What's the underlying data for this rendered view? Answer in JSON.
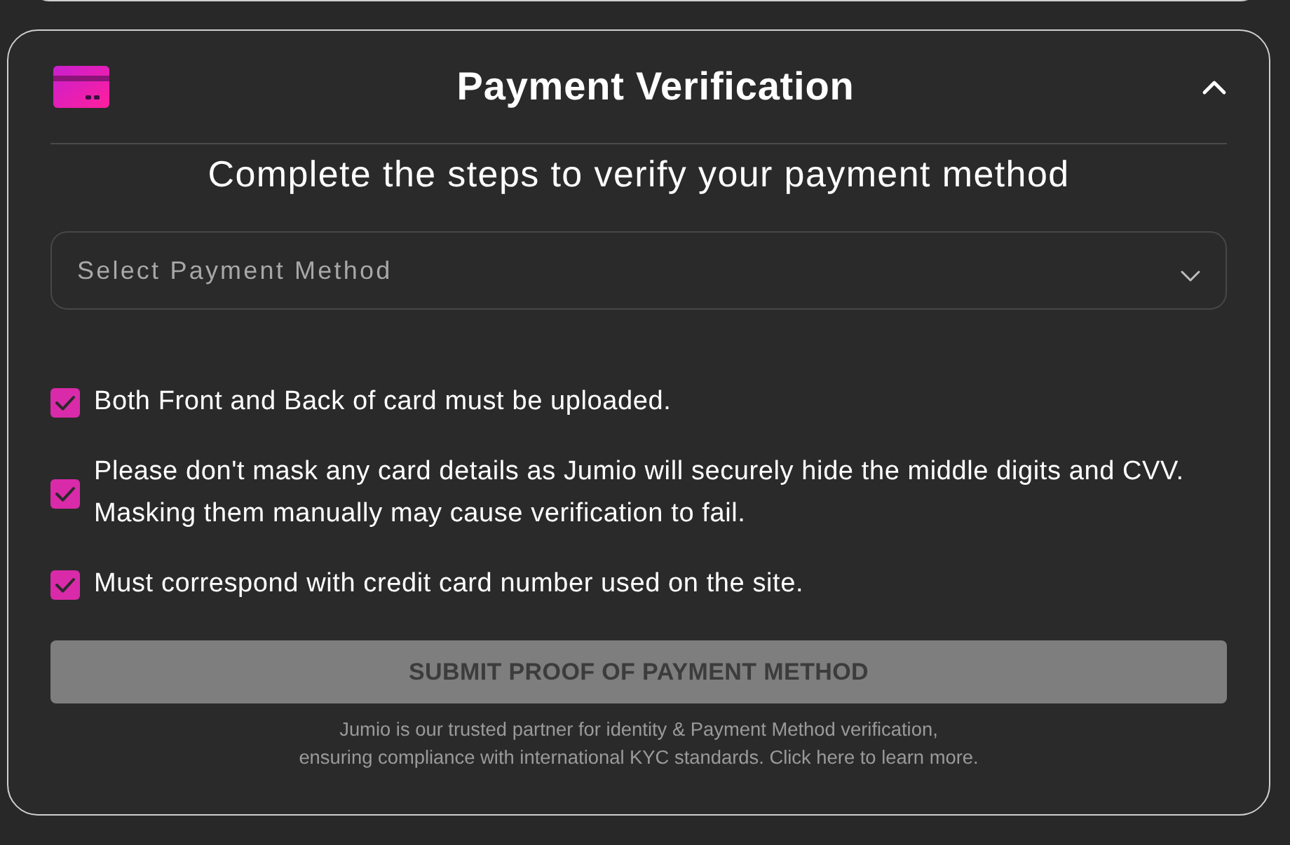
{
  "panel": {
    "title": "Payment Verification",
    "expanded": true
  },
  "subtitle": "Complete the steps to verify your payment method",
  "payment_method": {
    "placeholder": "Select Payment Method"
  },
  "requirements": [
    {
      "text": "Both Front and Back of card must be uploaded.",
      "checked": true
    },
    {
      "text": "Please don't mask any card details as Jumio will securely hide the middle digits and CVV.\nMasking them manually may cause verification to fail.",
      "checked": true
    },
    {
      "text": "Must correspond with credit card number used on the site.",
      "checked": true
    }
  ],
  "submit_button": {
    "label": "SUBMIT PROOF OF PAYMENT METHOD",
    "disabled": true
  },
  "footer_note": "Jumio is our trusted partner for identity & Payment Method verification,\nensuring compliance with international KYC standards. Click here to learn more."
}
